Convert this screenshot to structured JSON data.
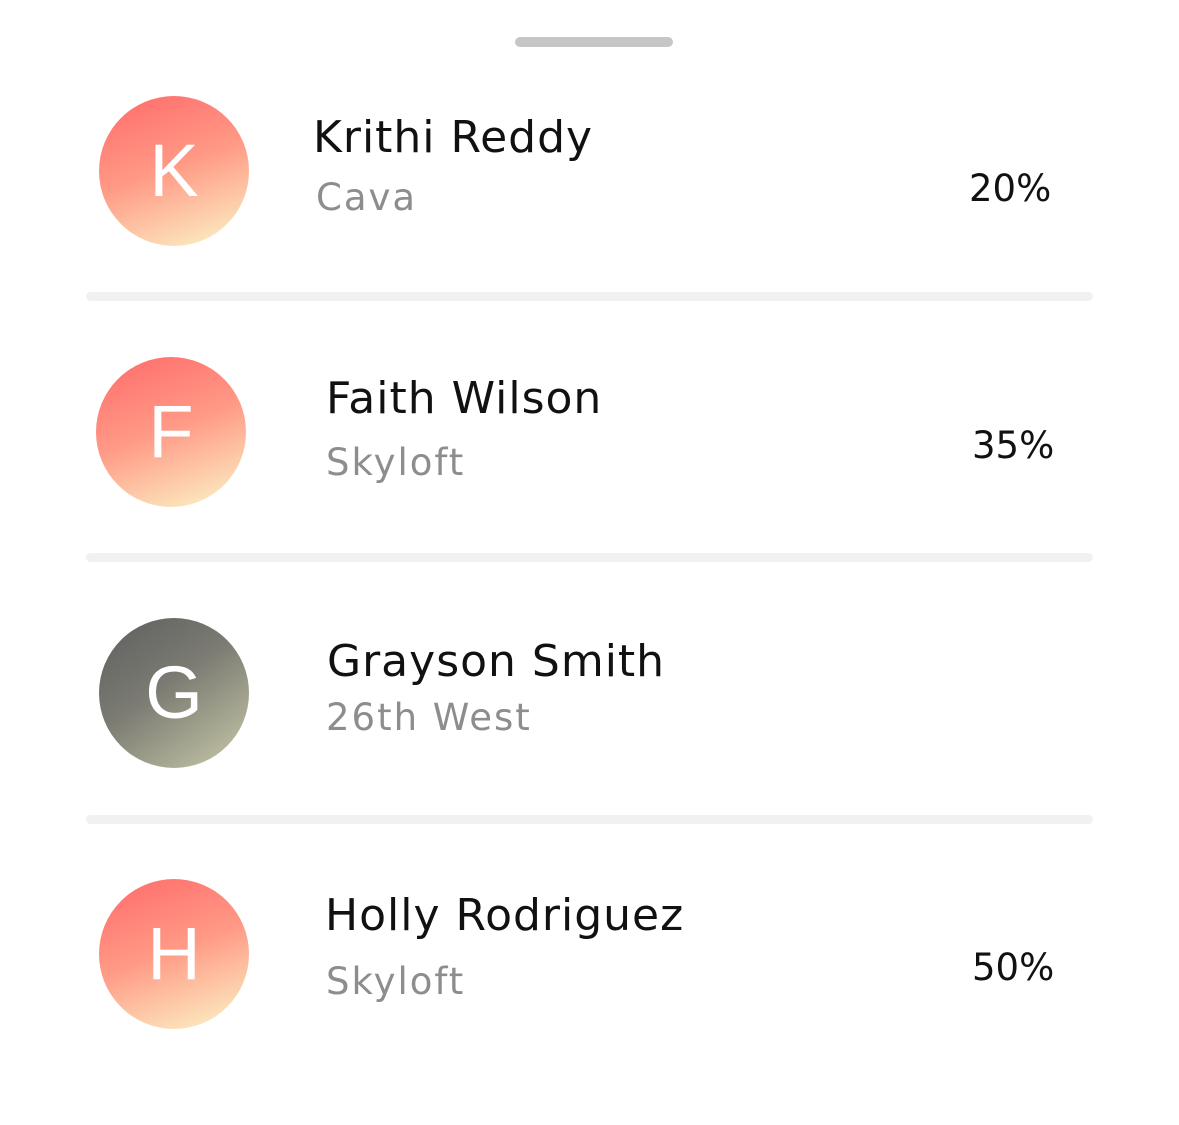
{
  "contacts": [
    {
      "initial": "K",
      "name": "Krithi Reddy",
      "company": "Cava",
      "percent": "20%",
      "avatar_style": "warm"
    },
    {
      "initial": "F",
      "name": "Faith Wilson",
      "company": "Skyloft",
      "percent": "35%",
      "avatar_style": "warm"
    },
    {
      "initial": "G",
      "name": "Grayson Smith",
      "company": "26th West",
      "percent": "",
      "avatar_style": "gray"
    },
    {
      "initial": "H",
      "name": "Holly Rodriguez",
      "company": "Skyloft",
      "percent": "50%",
      "avatar_style": "warm"
    }
  ],
  "colors": {
    "avatar_warm_start": "#ff6a6a",
    "avatar_warm_end": "#fbf6c8",
    "avatar_gray_start": "#5d5d5d",
    "avatar_gray_end": "#c9caa8",
    "secondary_text": "#8d8d8d",
    "divider": "#f1f1f1",
    "grabber": "#c6c6c6"
  }
}
